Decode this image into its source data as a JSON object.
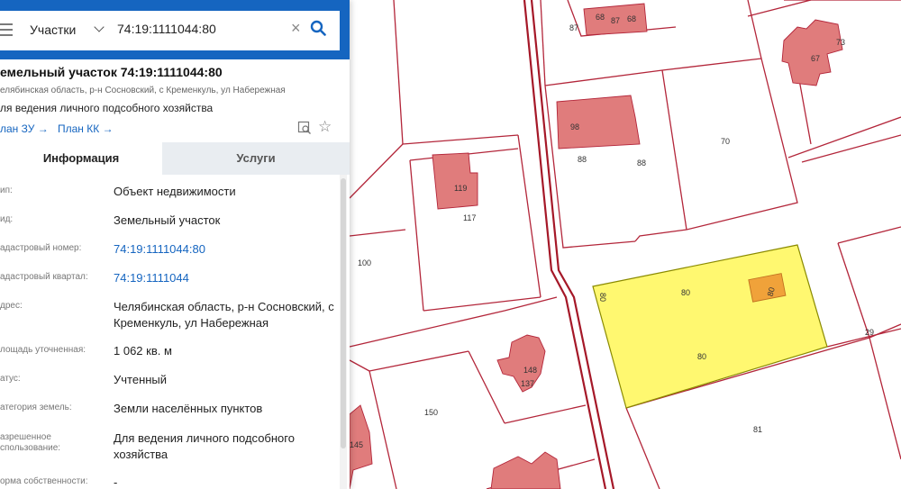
{
  "search": {
    "type": "Участки",
    "query": "74:19:1111044:80"
  },
  "parcel": {
    "title": "емельный участок 74:19:1111044:80",
    "address_short": "елябинская область, р-н Сосновский, с Кременкуль, ул Набережная",
    "purpose": "ля ведения личного подсобного хозяйства",
    "plan_zu": "лан ЗУ →",
    "plan_kk": "План КК →"
  },
  "tabs": [
    "Информация",
    "Услуги"
  ],
  "info_rows": [
    {
      "label": "ип:",
      "value": "Объект недвижимости"
    },
    {
      "label": "ид:",
      "value": "Земельный участок"
    },
    {
      "label": "адастровый номер:",
      "value": "74:19:1111044:80"
    },
    {
      "label": "адастровый квартал:",
      "value": "74:19:1111044"
    },
    {
      "label": "дрес:",
      "value": "Челябинская область, р-н Сосновский, с Кременкуль, ул Набережная"
    },
    {
      "label": "лощадь уточненная:",
      "value": "1 062 кв. м"
    },
    {
      "label": "атус:",
      "value": "Учтенный"
    },
    {
      "label": "атегория земель:",
      "value": "Земли населённых пунктов"
    },
    {
      "label": "азрешенное",
      "label2": "спользование:",
      "value": "Для ведения личного подсобного хозяйства"
    },
    {
      "label": "орма собственности:",
      "value": "-"
    }
  ],
  "colors": {
    "brand": "#1565c0",
    "parcel_line": "#b3263a",
    "building": "#e07c7c",
    "selected_parcel": "#fff870"
  },
  "map": {
    "labels": [
      "68",
      "87",
      "68",
      "87",
      "67",
      "73",
      "98",
      "70",
      "88",
      "88",
      "119",
      "117",
      "100",
      "80",
      "80",
      "80",
      "80",
      "148",
      "137",
      "150",
      "29",
      "81",
      "145"
    ]
  }
}
